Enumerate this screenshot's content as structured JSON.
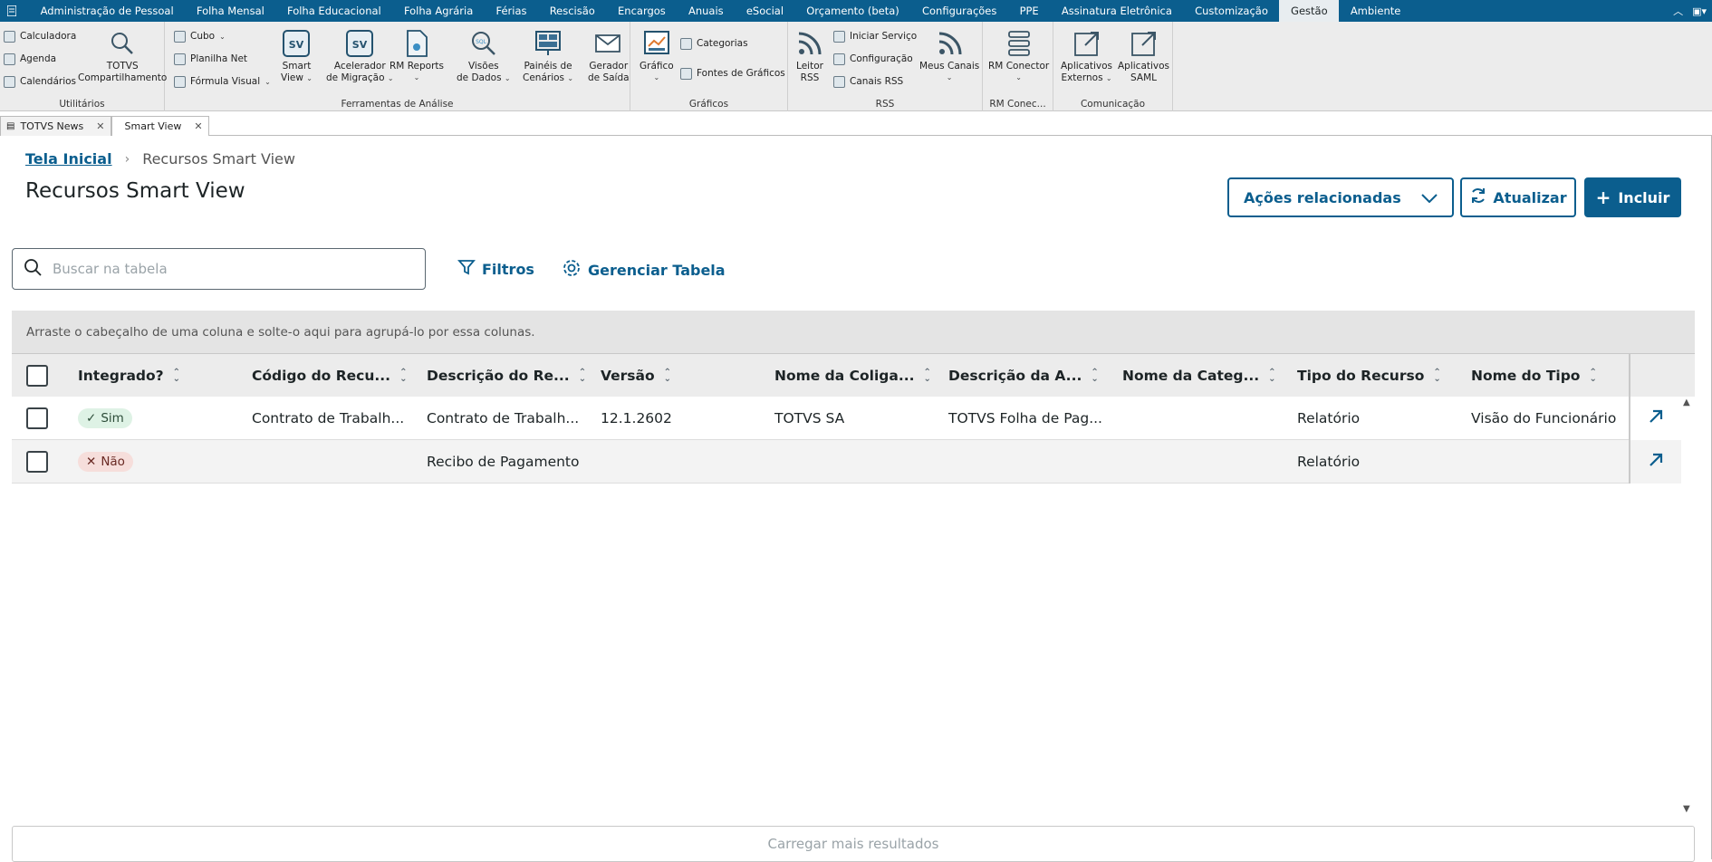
{
  "menubar": {
    "tabs": [
      "Administração de Pessoal",
      "Folha Mensal",
      "Folha Educacional",
      "Folha Agrária",
      "Férias",
      "Rescisão",
      "Encargos",
      "Anuais",
      "eSocial",
      "Orçamento (beta)",
      "Configurações",
      "PPE",
      "Assinatura Eletrônica",
      "Customização",
      "Gestão",
      "Ambiente"
    ],
    "active": "Gestão"
  },
  "ribbon": {
    "utilitarios": {
      "title": "Utilitários",
      "calculadora": "Calculadora",
      "agenda": "Agenda",
      "calendarios": "Calendários",
      "totvs": "TOTVS",
      "compartilhamento": "Compartilhamento"
    },
    "ferramentas": {
      "title": "Ferramentas de Análise",
      "cubo": "Cubo",
      "planilha": "Planilha Net",
      "formula": "Fórmula Visual",
      "smart1": "Smart",
      "smart2": "View",
      "acel1": "Acelerador",
      "acel2": "de Migração",
      "rmreports": "RM Reports",
      "visoes1": "Visões",
      "visoes2": "de Dados",
      "paineis1": "Painéis de",
      "paineis2": "Cenários",
      "gerador1": "Gerador",
      "gerador2": "de Saída"
    },
    "graficos": {
      "title": "Gráficos",
      "grafico": "Gráfico",
      "categorias": "Categorias",
      "fontes": "Fontes de Gráficos"
    },
    "rss": {
      "title": "RSS",
      "leitor1": "Leitor",
      "leitor2": "RSS",
      "iniciar": "Iniciar Serviço",
      "configuracao": "Configuração",
      "canais": "Canais RSS",
      "meus": "Meus Canais"
    },
    "rmconec": {
      "title": "RM Conec...",
      "rmconector": "RM Conector"
    },
    "comunicacao": {
      "title": "Comunicação",
      "aplic1": "Aplicativos",
      "aplic2": "Externos",
      "saml1": "Aplicativos",
      "saml2": "SAML"
    }
  },
  "doctabs": [
    {
      "label": "TOTVS News"
    },
    {
      "label": "Smart View"
    }
  ],
  "page": {
    "breadcrumb_home": "Tela Inicial",
    "breadcrumb_current": "Recursos Smart View",
    "title": "Recursos Smart View",
    "actions_label": "Ações relacionadas",
    "refresh_label": "Atualizar",
    "add_label": "Incluir",
    "search_placeholder": "Buscar na tabela",
    "filters_label": "Filtros",
    "manage_label": "Gerenciar Tabela",
    "group_hint": "Arraste o cabeçalho de uma coluna e solte-o aqui para agrupá-lo por essa colunas.",
    "load_more": "Carregar mais resultados"
  },
  "table": {
    "columns": [
      "Integrado?",
      "Código do Recu...",
      "Descrição do Re...",
      "Versão",
      "Nome da Coliga...",
      "Descrição da A...",
      "Nome da Categ...",
      "Tipo do Recurso",
      "Nome do Tipo"
    ],
    "rows": [
      {
        "integrado": "Sim",
        "codigo": "Contrato de Trabalh...",
        "descricao": "Contrato de Trabalh...",
        "versao": "12.1.2602",
        "coligada": "TOTVS SA",
        "descricao_a": "TOTVS Folha de Pag...",
        "categoria": "",
        "tipo": "Relatório",
        "nome_tipo": "Visão do Funcionário"
      },
      {
        "integrado": "Não",
        "codigo": "",
        "descricao": "Recibo de Pagamento",
        "versao": "",
        "coligada": "",
        "descricao_a": "",
        "categoria": "",
        "tipo": "Relatório",
        "nome_tipo": ""
      }
    ]
  },
  "colors": {
    "primary": "#0b5e8e",
    "success_bg": "#def2e5",
    "danger_bg": "#f6dedb"
  }
}
